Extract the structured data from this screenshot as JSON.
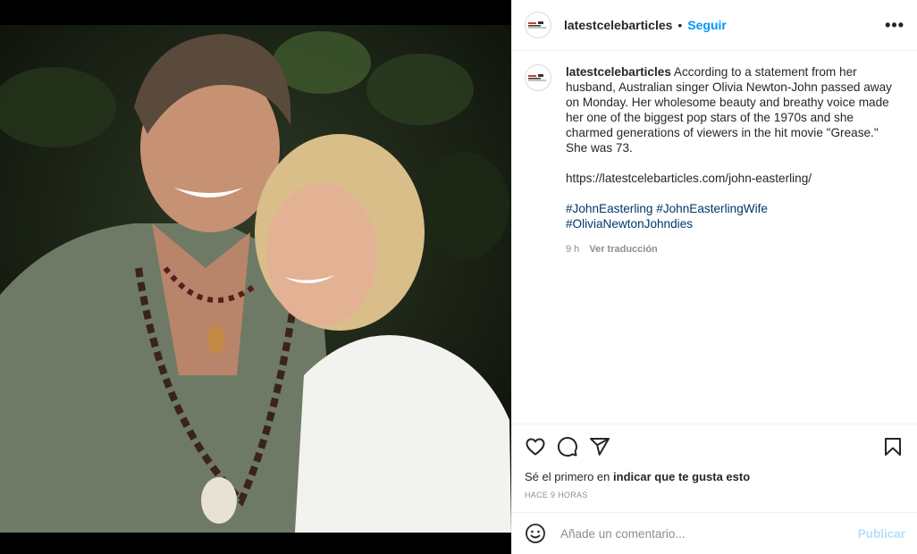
{
  "post": {
    "username": "latestcelebarticles",
    "separator": "•",
    "follow_label": "Seguir",
    "more_label": "•••",
    "caption": {
      "username": "latestcelebarticles",
      "text": "According to a statement from her husband, Australian singer Olivia Newton-John passed away on Monday. Her wholesome beauty and breathy voice made her one of the biggest pop stars of the 1970s and she charmed generations of viewers in the hit movie \"Grease.\" She was 73.",
      "link": "https://latestcelebarticles.com/john-easterling/",
      "hashtags": "#JohnEasterling #JohnEasterlingWife #OliviaNewtonJohndies",
      "time": "9 h",
      "translate_label": "Ver traducción"
    },
    "likes": {
      "prefix": "Sé el primero en",
      "action": "indicar que te gusta esto"
    },
    "time_ago": "HACE 9 HORAS",
    "comment": {
      "placeholder": "Añade un comentario...",
      "publish_label": "Publicar"
    }
  },
  "icons": {
    "heart": "heart-icon",
    "comment": "comment-icon",
    "share": "share-icon",
    "save": "bookmark-icon",
    "emoji": "emoji-icon"
  },
  "colors": {
    "link_blue": "#0095f6",
    "hashtag": "#00376b",
    "muted": "#8e8e8e",
    "publish_disabled": "#b2dffc"
  }
}
